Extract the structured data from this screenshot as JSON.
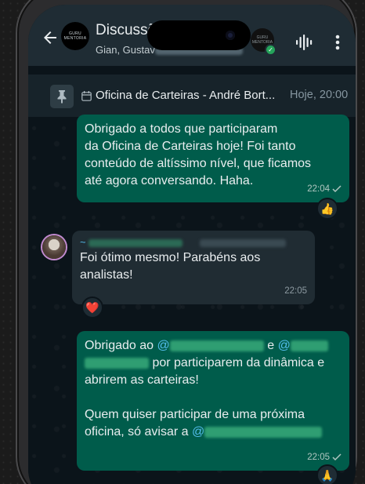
{
  "header": {
    "back_icon": "arrow-left-icon",
    "group_avatar_text": "GURU\nMENTORIA",
    "title": "Discussõ",
    "subtitle_prefix": "Gian, Gustav",
    "call_avatar_text": "GURU\nMENTORIA",
    "voice_icon": "voice-waveform-icon",
    "more_icon": "more-vertical-icon"
  },
  "pinned": {
    "pin_icon": "pin-icon",
    "calendar_icon": "calendar-icon",
    "text": "Oficina de Carteiras - André Bort...",
    "time": "Hoje, 20:00"
  },
  "messages": [
    {
      "direction": "outgoing",
      "lines": [
        "Obrigado a todos que participaram",
        "da Oficina de Carteiras hoje! Foi tanto",
        "conteúdo de altíssimo nível, que ficamos",
        "até agora conversando. Haha."
      ],
      "time": "22:04",
      "reaction": "👍"
    },
    {
      "direction": "incoming",
      "sender_prefix": "~",
      "lines": [
        "Foi ótimo mesmo! Parabéns aos",
        "analistas!"
      ],
      "time": "22:05",
      "reaction": "❤️"
    },
    {
      "direction": "outgoing",
      "line1_a": "Obrigado ao ",
      "mention_at": "@",
      "line1_and": "e",
      "line2_b": "por participarem da dinâmica e",
      "line3": "abrirem as carteiras!",
      "line4": "Quem quiser participar de uma próxima",
      "line5_a": "oficina, só avisar a ",
      "time": "22:05",
      "reaction": "🙏"
    }
  ],
  "colors": {
    "outgoing_bubble": "#005c4b",
    "incoming_bubble": "#202c33",
    "header": "#1f2c34",
    "mention": "#53bdeb"
  }
}
